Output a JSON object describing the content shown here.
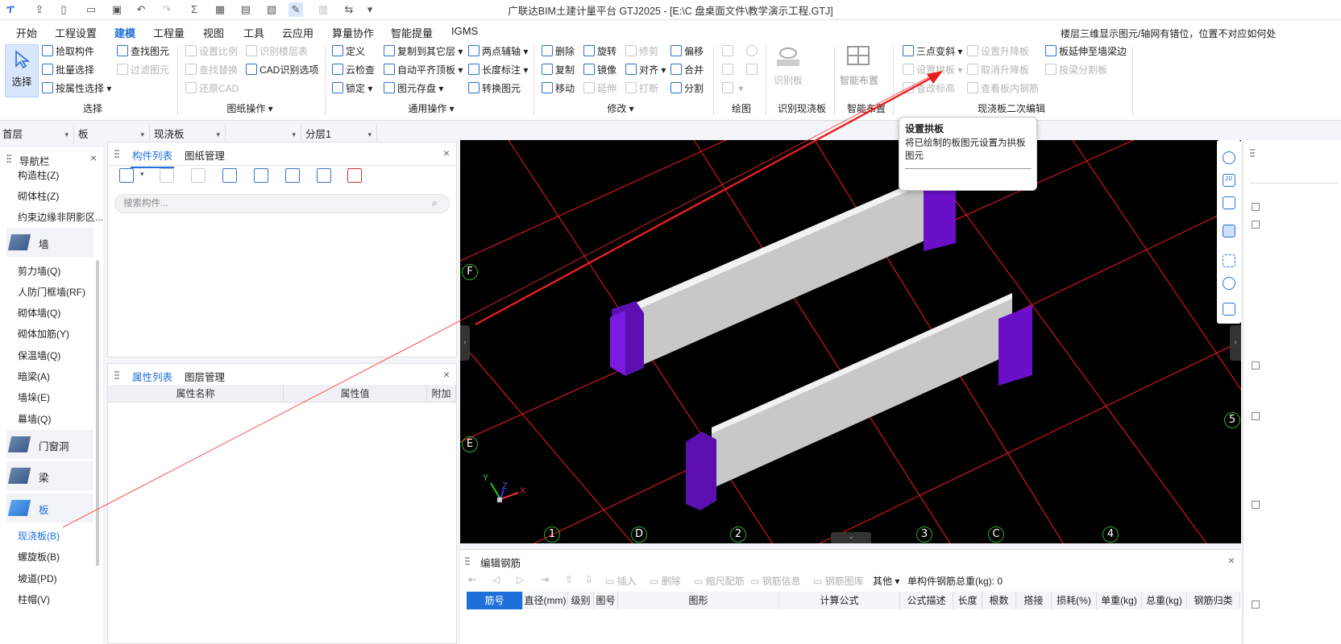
{
  "window": {
    "title": "广联达BIM土建计量平台 GTJ2025 - [E:\\C 盘桌面文件\\教学演示工程.GTJ]"
  },
  "menu": {
    "tabs": [
      "开始",
      "工程设置",
      "建模",
      "工程量",
      "视图",
      "工具",
      "云应用",
      "算量协作",
      "智能提量",
      "IGMS"
    ],
    "active": "建模",
    "notice": "楼层三维显示图元/轴网有错位，位置不对应如何处"
  },
  "ribbon": {
    "select": {
      "label": "选择",
      "items": [
        "拾取构件",
        "批量选择",
        "按属性选择",
        "查找图元",
        "过滤图元"
      ],
      "group": "选择"
    },
    "drawing": {
      "items": [
        "设置比例",
        "识别楼层表",
        "CAD识别选项",
        "查找替换",
        "还原CAD"
      ],
      "group": "图纸操作"
    },
    "common": {
      "items": [
        "定义",
        "复制到其它层",
        "两点辅轴",
        "云检查",
        "自动平齐顶板",
        "长度标注",
        "锁定",
        "图元存盘",
        "转换图元"
      ],
      "group": "通用操作"
    },
    "modify": {
      "items": [
        "删除",
        "旋转",
        "修剪",
        "偏移",
        "复制",
        "镜像",
        "对齐",
        "合并",
        "移动",
        "延伸",
        "打断",
        "分割"
      ],
      "group": "修改"
    },
    "draw": {
      "group": "绘图"
    },
    "recognize": {
      "label": "识别板",
      "group": "识别现浇板"
    },
    "smart": {
      "label": "智能布置",
      "group": "智能布置"
    },
    "secondary": {
      "items": [
        "三点变斜",
        "设置升降板",
        "板延伸至墙梁边",
        "设置拱板",
        "取消升降板",
        "按梁分割板",
        "查改标高",
        "查看板内钢筋"
      ],
      "group": "现浇板二次编辑"
    }
  },
  "floorbar": {
    "floor": "首层",
    "type": "板",
    "sub": "现浇板",
    "blank": "",
    "layer": "分层1"
  },
  "nav": {
    "title": "导航栏",
    "top_items": [
      "构造柱(Z)",
      "砌体柱(Z)",
      "约束边缘非阴影区..."
    ],
    "cat_wall": "墙",
    "wall_items": [
      "剪力墙(Q)",
      "人防门框墙(RF)",
      "砌体墙(Q)",
      "砌体加筋(Y)",
      "保温墙(Q)",
      "暗梁(A)",
      "墙垛(E)",
      "幕墙(Q)"
    ],
    "cat_door": "门窗洞",
    "cat_beam": "梁",
    "cat_slab": "板",
    "slab_items": [
      "现浇板(B)",
      "螺旋板(B)",
      "坡道(PD)",
      "柱帽(V)"
    ]
  },
  "component_panel": {
    "tabs": [
      "构件列表",
      "图纸管理"
    ],
    "search_placeholder": "搜索构件..."
  },
  "property_panel": {
    "tabs": [
      "属性列表",
      "图层管理"
    ],
    "columns": [
      "属性名称",
      "属性值",
      "附加"
    ]
  },
  "viewport": {
    "axis_labels": [
      "F",
      "E",
      "1",
      "D",
      "2",
      "3",
      "C",
      "4",
      "5"
    ],
    "axes": [
      "X",
      "Y",
      "Z"
    ]
  },
  "tooltip": {
    "title": "设置拱板",
    "description": "将已绘制的板图元设置为拱板图元"
  },
  "rebar_panel": {
    "title": "编辑钢筋",
    "tools": [
      "插入",
      "删除",
      "缩尺配筋",
      "钢筋信息",
      "钢筋图库",
      "其他"
    ],
    "total_label": "单构件钢筋总重(kg): 0",
    "columns": [
      "筋号",
      "直径(mm)",
      "级别",
      "图号",
      "图形",
      "计算公式",
      "公式描述",
      "长度",
      "根数",
      "搭接",
      "损耗(%)",
      "单重(kg)",
      "总重(kg)",
      "钢筋归类"
    ]
  },
  "colors": {
    "accent": "#1e6fd9",
    "column": "#6a10c8",
    "beam": "#b7b7b7",
    "grid": "#ff1a1a"
  }
}
